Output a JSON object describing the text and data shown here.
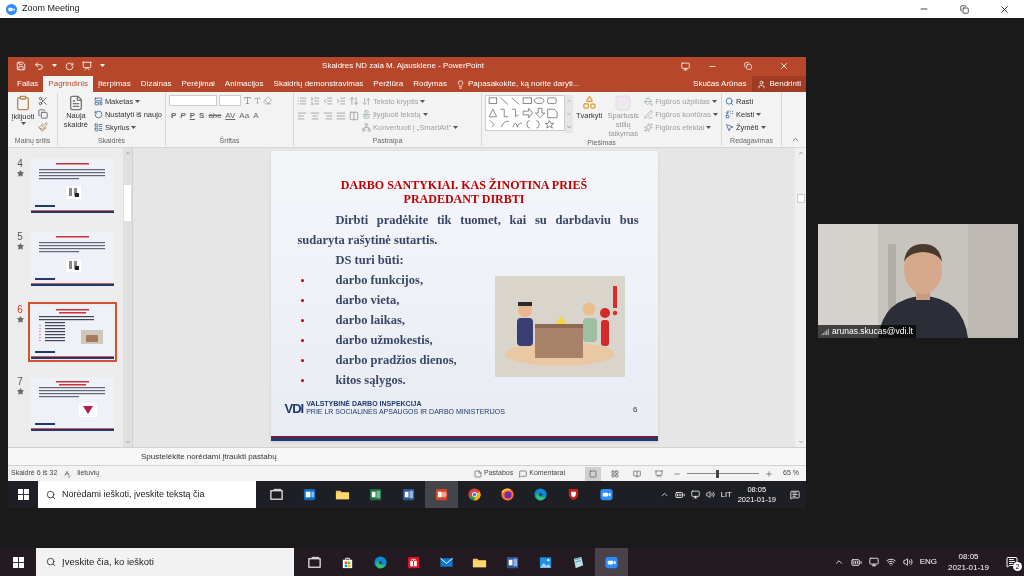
{
  "zoom_window": {
    "title": "Zoom Meeting"
  },
  "powerpoint": {
    "title": "Skaidres ND zala M. Ajauskiene - PowerPoint",
    "tabs": [
      {
        "label": "Failas",
        "selected": false
      },
      {
        "label": "Pagrindinis",
        "selected": true
      },
      {
        "label": "Įterpimas",
        "selected": false
      },
      {
        "label": "Dizainas",
        "selected": false
      },
      {
        "label": "Perėjimai",
        "selected": false
      },
      {
        "label": "Animacijos",
        "selected": false
      },
      {
        "label": "Skaidrių demonstravimas",
        "selected": false
      },
      {
        "label": "Peržiūra",
        "selected": false
      },
      {
        "label": "Rodymas",
        "selected": false
      }
    ],
    "tell_me": {
      "placeholder": "Papasakokite, ką norite daryti..."
    },
    "account": "Skučas Arūnas",
    "share": "Bendrinti",
    "ribbon": {
      "clipboard": {
        "label": "Mainų sritis",
        "paste": "Įklijuoti"
      },
      "slides": {
        "label": "Skaidrės",
        "new_slide": "Nauja skaidrė",
        "layout": "Maketas",
        "reset": "Nustatyti iš naujo",
        "section": "Skyrius"
      },
      "font": {
        "label": "Šriftas",
        "buttons": [
          {
            "label": "P",
            "kind": "bold"
          },
          {
            "label": "P",
            "kind": "italic"
          },
          {
            "label": "P",
            "kind": "underline"
          },
          {
            "label": "S",
            "kind": "shadow"
          },
          {
            "label": "abc",
            "kind": "strike"
          },
          {
            "label": "AV",
            "kind": "spacing"
          },
          {
            "label": "Aa",
            "kind": "case"
          },
          {
            "label": "A",
            "kind": "color"
          }
        ]
      },
      "paragraph": {
        "label": "Pastraipa",
        "text_direction": "Teksto kryptis",
        "align_text": "Įlygiuoti tekstą",
        "smartart": "Konvertuoti į „SmartArt“"
      },
      "drawing": {
        "label": "Piešimas",
        "arrange": "Tvarkyti",
        "quick_styles": "Spartusis stilių taikymas",
        "shape_fill": "Figūros užpildas",
        "shape_outline": "Figūros kontūras",
        "shape_effects": "Figūros efektai"
      },
      "editing": {
        "label": "Redagavimas",
        "find": "Rasti",
        "replace": "Keisti",
        "select": "Žymėti"
      }
    },
    "thumbnails": [
      {
        "number": "4",
        "selected": false,
        "kind": "figures"
      },
      {
        "number": "5",
        "selected": false,
        "kind": "figures"
      },
      {
        "number": "6",
        "selected": true,
        "kind": "list"
      },
      {
        "number": "7",
        "selected": false,
        "kind": "logo"
      }
    ],
    "slide": {
      "title": "DARBO SANTYKIAI. KAS ŽINOTINA PRIEŠ PRADEDANT DIRBTI",
      "paragraph": "Dirbti pradėkite tik tuomet, kai su darbdaviu bus sudaryta rašytinė sutartis.",
      "subheading": "DS turi būti:",
      "bullets": [
        "darbo funkcijos,",
        "darbo vieta,",
        "darbo laikas,",
        "darbo užmokestis,",
        "darbo pradžios dienos,",
        "kitos sąlygos."
      ],
      "logo": {
        "mark": "VDI",
        "name": "VALSTYBINĖ DARBO INSPEKCIJA",
        "subtitle": "PRIE LR SOCIALINĖS APSAUGOS IR DARBO MINISTERIJOS"
      },
      "page_number": "6"
    },
    "notes": {
      "placeholder": "Spustelėkite norėdami įtraukti pastabų"
    },
    "status_bar": {
      "slide_counter": "Skaidrė 6 iš 32",
      "language": "lietuvių",
      "notes": "Pastabos",
      "comments": "Komentarai",
      "zoom_slider": {
        "level": 0.42
      },
      "zoom": "65 %"
    }
  },
  "shared_taskbar": {
    "search": {
      "placeholder": "Norėdami ieškoti, įveskite tekstą čia"
    },
    "apps": [
      {
        "kind": "task-view",
        "selected": false
      },
      {
        "kind": "outlook",
        "selected": false
      },
      {
        "kind": "explorer",
        "selected": false
      },
      {
        "kind": "excel",
        "selected": false
      },
      {
        "kind": "word",
        "selected": false
      },
      {
        "kind": "powerpoint",
        "selected": true
      },
      {
        "kind": "chrome",
        "selected": false
      },
      {
        "kind": "firefox",
        "selected": false
      },
      {
        "kind": "edge",
        "selected": false
      },
      {
        "kind": "shield",
        "selected": false
      },
      {
        "kind": "zoom",
        "selected": false
      }
    ],
    "language": "LIT",
    "time": "08:05",
    "date": "2021-01-19"
  },
  "participant": {
    "name": "arunas.skucas@vdi.lt"
  },
  "taskbar": {
    "search": {
      "placeholder": "Įveskite čia, ko ieškoti"
    },
    "apps": [
      {
        "kind": "task-view",
        "selected": false
      },
      {
        "kind": "store",
        "selected": false
      },
      {
        "kind": "edge",
        "selected": false
      },
      {
        "kind": "gift",
        "selected": false
      },
      {
        "kind": "mail",
        "selected": false
      },
      {
        "kind": "explorer",
        "selected": false
      },
      {
        "kind": "word",
        "selected": false
      },
      {
        "kind": "photos",
        "selected": false
      },
      {
        "kind": "notepad",
        "selected": false
      },
      {
        "kind": "zoom",
        "selected": true
      }
    ],
    "language": "ENG",
    "time": "08:05",
    "date": "2021-01-19",
    "notifications": "2"
  }
}
